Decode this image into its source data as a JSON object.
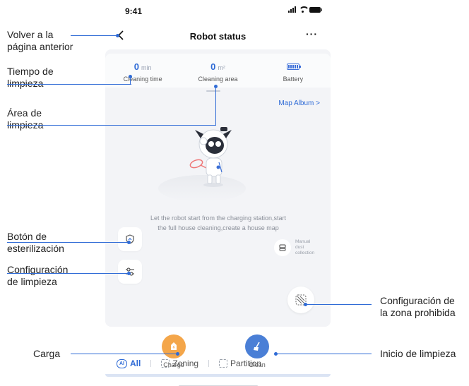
{
  "status_bar": {
    "time": "9:41"
  },
  "nav": {
    "title": "Robot status",
    "more": "···"
  },
  "stats": {
    "cleaning_time": {
      "value": "0",
      "unit": "min",
      "label": "Cleaning time"
    },
    "cleaning_area": {
      "value": "0",
      "unit": "m²",
      "label": "Cleaning area"
    },
    "battery": {
      "label": "Battery"
    }
  },
  "map": {
    "album_link": "Map Album >",
    "description_line1": "Let the robot start from the charging station,start",
    "description_line2": "the full house cleaning,create a house map"
  },
  "manual_dust": {
    "line1": "Manual",
    "line2": "dust",
    "line3": "collection"
  },
  "modes": {
    "all": "All",
    "zoning": "Zoning",
    "partition": "Partition"
  },
  "actions": {
    "charge": "Charge",
    "clean": "Clean"
  },
  "annotations": {
    "back_line1": "Volver a la",
    "back_line2": "página anterior",
    "time_line1": "Tiempo de",
    "time_line2": "limpieza",
    "area_line1": "Área de",
    "area_line2": "limpieza",
    "steril_line1": "Botón de",
    "steril_line2": "esterilización",
    "config_line1": "Configuración",
    "config_line2": "de limpieza",
    "forbid_line1": "Configuración de",
    "forbid_line2": "la zona prohibida",
    "charge": "Carga",
    "clean": "Inicio de limpieza"
  },
  "colors": {
    "accent": "#2f6bd6",
    "charge": "#f4a64a",
    "clean": "#4a7fd6"
  }
}
